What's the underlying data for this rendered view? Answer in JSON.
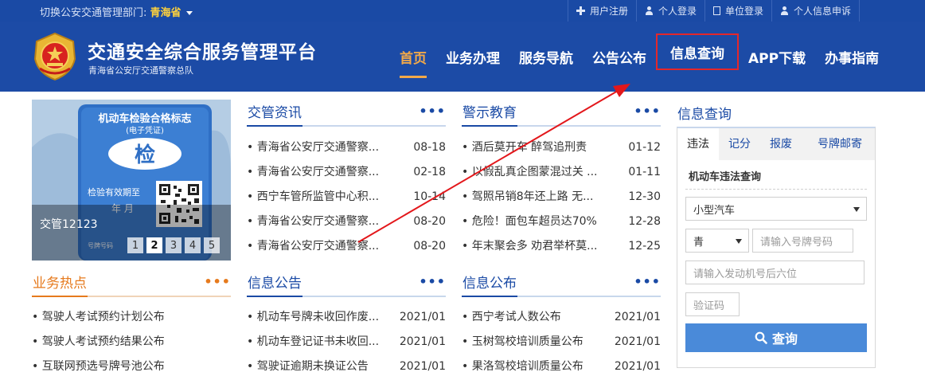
{
  "topbar": {
    "region_label": "切换公安交通管理部门:",
    "region_value": "青海省",
    "links": [
      {
        "label": "用户注册",
        "icon": "plus-icon"
      },
      {
        "label": "个人登录",
        "icon": "user-icon"
      },
      {
        "label": "单位登录",
        "icon": "document-icon"
      },
      {
        "label": "个人信息申诉",
        "icon": "user-icon"
      }
    ]
  },
  "header": {
    "title": "交通安全综合服务管理平台",
    "subtitle": "青海省公安厅交通警察总队",
    "nav": [
      "首页",
      "业务办理",
      "服务导航",
      "公告公布",
      "信息查询",
      "APP下载",
      "办事指南"
    ]
  },
  "banner": {
    "card_title": "机动车检验合格标志",
    "card_subtitle": "(电子凭证)",
    "card_badge": "检",
    "card_validity": "检验有效期至",
    "card_date": "年  月",
    "card_plate": "号牌号码",
    "caption": "交管12123",
    "pages": [
      "1",
      "2",
      "3",
      "4",
      "5"
    ],
    "active_page": "2"
  },
  "news": {
    "title": "交管资讯",
    "items": [
      {
        "text": "• 青海省公安厅交通警察...",
        "date": "08-18"
      },
      {
        "text": "• 青海省公安厅交通警察...",
        "date": "02-18"
      },
      {
        "text": "• 西宁车管所监管中心积...",
        "date": "10-14"
      },
      {
        "text": "• 青海省公安厅交通警察...",
        "date": "08-20"
      },
      {
        "text": "• 青海省公安厅交通警察...",
        "date": "08-20"
      }
    ]
  },
  "warning": {
    "title": "警示教育",
    "items": [
      {
        "text": "• 酒后莫开车 醉驾追刑责",
        "date": "01-12"
      },
      {
        "text": "• 以假乱真企图蒙混过关 ...",
        "date": "01-11"
      },
      {
        "text": "• 驾照吊销8年还上路 无...",
        "date": "12-30"
      },
      {
        "text": "• 危险！面包车超员达70%",
        "date": "12-28"
      },
      {
        "text": "• 年末聚会多 劝君举杯莫...",
        "date": "12-25"
      }
    ]
  },
  "hot": {
    "title": "业务热点",
    "items": [
      "• 驾驶人考试预约计划公布",
      "• 驾驶人考试预约结果公布",
      "• 互联网预选号牌号池公布"
    ]
  },
  "notice": {
    "title": "信息公告",
    "items": [
      {
        "text": "• 机动车号牌未收回作废...",
        "date": "2021/01"
      },
      {
        "text": "• 机动车登记证书未收回...",
        "date": "2021/01"
      },
      {
        "text": "• 驾驶证逾期未换证公告",
        "date": "2021/01"
      }
    ]
  },
  "publish": {
    "title": "信息公布",
    "items": [
      {
        "text": "• 西宁考试人数公布",
        "date": "2021/01"
      },
      {
        "text": "• 玉树驾校培训质量公布",
        "date": "2021/01"
      },
      {
        "text": "• 果洛驾校培训质量公布",
        "date": "2021/01"
      }
    ]
  },
  "query": {
    "title": "信息查询",
    "tabs": [
      "违法",
      "记分",
      "报废",
      "号牌邮寄"
    ],
    "subtitle": "机动车违法查询",
    "vehicle_type": "小型汽车",
    "plate_prefix": "青",
    "plate_placeholder": "请输入号牌号码",
    "engine_placeholder": "请输入发动机号后六位",
    "captcha_placeholder": "验证码",
    "submit": "查询"
  },
  "more_label": "•••",
  "colors": {
    "header_bg": "#1c4ba6",
    "topbar_bg": "#1a4aa5",
    "active_nav": "#f2a949",
    "highlight_box": "#e4272a",
    "annotation_arrow": "#e3171b",
    "query_button": "#4a8ad9",
    "hot_accent": "#e67a1d"
  }
}
